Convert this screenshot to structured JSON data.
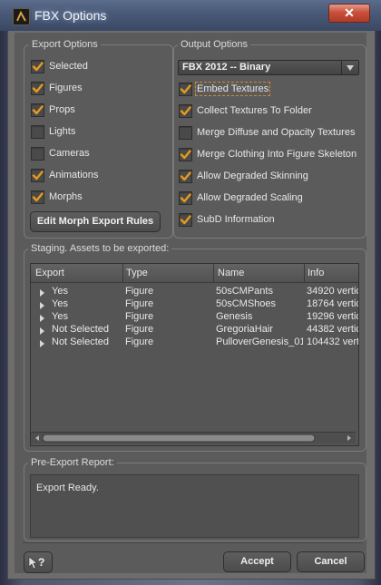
{
  "window": {
    "title": "FBX Options",
    "close_symbol": "✕"
  },
  "export_options": {
    "label": "Export Options",
    "items": [
      {
        "label": "Selected",
        "checked": true
      },
      {
        "label": "Figures",
        "checked": true
      },
      {
        "label": "Props",
        "checked": true
      },
      {
        "label": "Lights",
        "checked": false
      },
      {
        "label": "Cameras",
        "checked": false
      },
      {
        "label": "Animations",
        "checked": true
      },
      {
        "label": "Morphs",
        "checked": true
      }
    ],
    "morph_rules_button": "Edit Morph Export Rules"
  },
  "output_options": {
    "label": "Output Options",
    "format": "FBX 2012 -- Binary",
    "items": [
      {
        "label": "Embed Textures",
        "checked": true
      },
      {
        "label": "Collect Textures To Folder",
        "checked": true
      },
      {
        "label": "Merge Diffuse and Opacity Textures",
        "checked": false
      },
      {
        "label": "Merge Clothing Into Figure Skeleton",
        "checked": true
      },
      {
        "label": "Allow Degraded Skinning",
        "checked": true
      },
      {
        "label": "Allow Degraded Scaling",
        "checked": true
      },
      {
        "label": "SubD Information",
        "checked": true
      }
    ]
  },
  "staging": {
    "label": "Staging. Assets to be exported:",
    "columns": [
      "Export",
      "Type",
      "Name",
      "Info"
    ],
    "rows": [
      {
        "export": "Yes",
        "type": "Figure",
        "name": "50sCMPants",
        "info": "34920 vertic"
      },
      {
        "export": "Yes",
        "type": "Figure",
        "name": "50sCMShoes",
        "info": "18764 vertic"
      },
      {
        "export": "Yes",
        "type": "Figure",
        "name": "Genesis",
        "info": "19296 vertic"
      },
      {
        "export": "Not Selected",
        "type": "Figure",
        "name": "GregoriaHair",
        "info": "44382 vertic"
      },
      {
        "export": "Not Selected",
        "type": "Figure",
        "name": "PulloverGenesis_01",
        "info": "104432 vert"
      }
    ]
  },
  "report": {
    "label": "Pre-Export Report:",
    "text": "Export Ready."
  },
  "footer": {
    "help_label": "?",
    "accept": "Accept",
    "cancel": "Cancel"
  },
  "colors": {
    "check_orange": "#e89a1c",
    "titlebar": "#4a5a78",
    "close_red": "#c9503c"
  }
}
